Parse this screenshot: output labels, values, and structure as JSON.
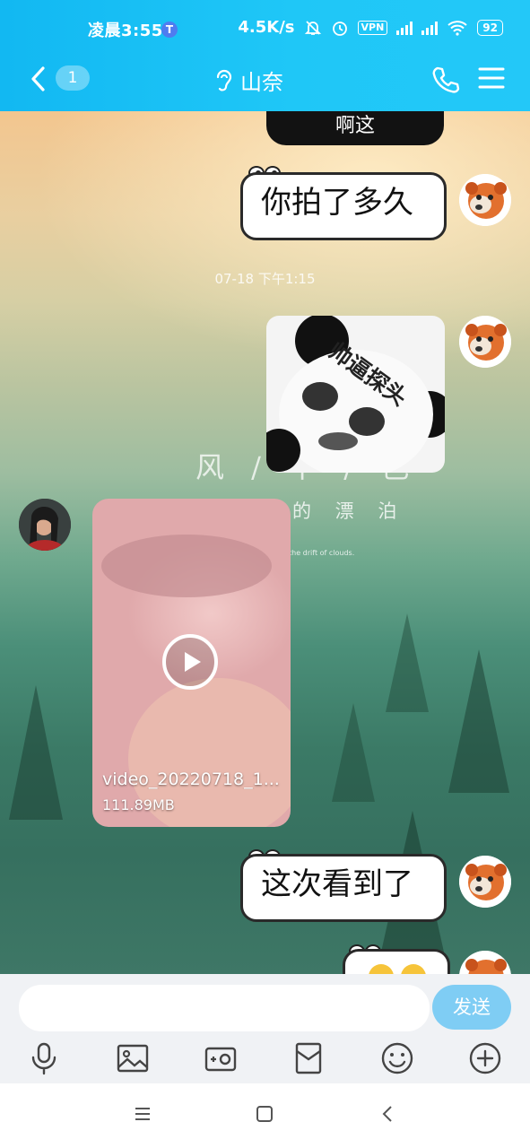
{
  "status_bar": {
    "time": "凌晨3:55",
    "badge": "T",
    "network_speed": "4.5K/s",
    "vpn_label": "VPN",
    "battery": "92"
  },
  "header": {
    "unread_count": "1",
    "contact_name": "山奈"
  },
  "chat": {
    "sticker_top_text": "啊这",
    "msg_1": "你拍了多久",
    "timestamp": "07-18 下午1:15",
    "panda_sticker_text": "帅逼探头",
    "wallpaper_title": "风 / 不 / 色",
    "wallpaper_line2": "的 漂 泊",
    "wallpaper_caption": "the drift of clouds.",
    "video": {
      "filename": "video_20220718_1...",
      "size": "111.89MB"
    },
    "msg_2": "这次看到了"
  },
  "input_bar": {
    "placeholder": "",
    "send_label": "发送"
  },
  "icons": {
    "back": "chevron-left-icon",
    "ear": "ear-icon",
    "phone": "phone-icon",
    "menu": "menu-icon",
    "mic": "microphone-icon",
    "image": "image-icon",
    "camera": "camera-icon",
    "red_packet": "red-packet-icon",
    "emoji": "emoji-icon",
    "plus": "plus-icon"
  },
  "colors": {
    "header": "#1fc7f7",
    "send_button": "#7fcdf4"
  }
}
